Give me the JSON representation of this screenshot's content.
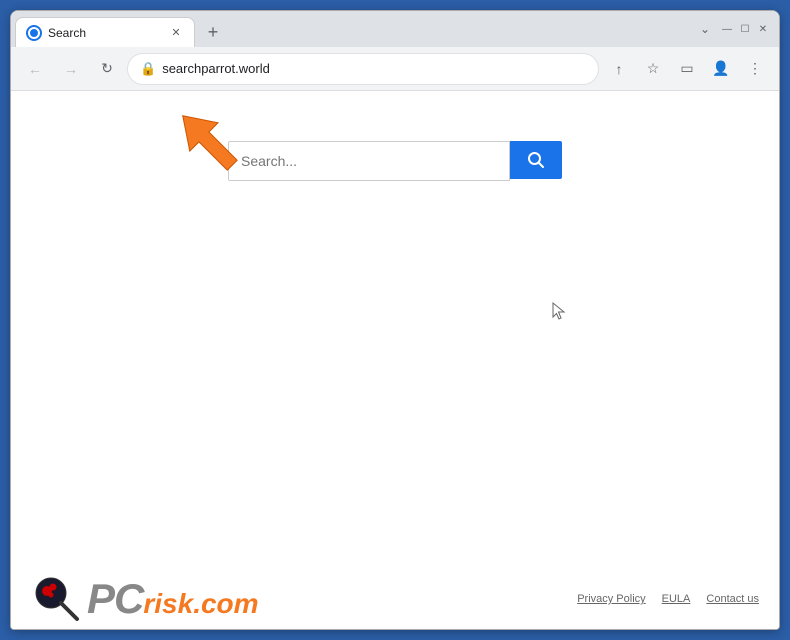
{
  "browser": {
    "tab_title": "Search",
    "new_tab_label": "+",
    "address": "searchparrot.world",
    "window_controls": {
      "chevron": "⌄",
      "minimize": "—",
      "maximize": "☐",
      "close": "✕"
    }
  },
  "nav": {
    "back_label": "←",
    "forward_label": "→",
    "reload_label": "↻",
    "share_icon": "↑",
    "bookmark_icon": "☆",
    "sidebar_icon": "▭",
    "profile_icon": "👤",
    "menu_icon": "⋮"
  },
  "page": {
    "search_placeholder": "Search...",
    "search_button_label": "🔍"
  },
  "footer": {
    "logo_pc": "PC",
    "logo_risk": "risk",
    "logo_dot": ".",
    "logo_com": "com",
    "links": [
      {
        "label": "Privacy Policy"
      },
      {
        "label": "EULA"
      },
      {
        "label": "Contact us"
      }
    ]
  }
}
